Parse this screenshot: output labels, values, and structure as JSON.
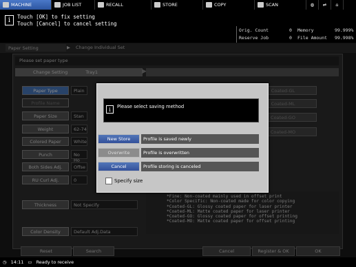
{
  "tabs": [
    {
      "label": "MACHINE",
      "icon": "machine-icon",
      "active": true
    },
    {
      "label": "JOB LIST",
      "icon": "job-list-icon"
    },
    {
      "label": "RECALL",
      "icon": "recall-icon"
    },
    {
      "label": "STORE",
      "icon": "store-icon"
    },
    {
      "label": "COPY",
      "icon": "copy-icon"
    },
    {
      "label": "SCAN",
      "icon": "scan-icon"
    }
  ],
  "message": {
    "line1": "Touch [OK] to fix setting",
    "line2": "Touch [Cancel] to cancel setting"
  },
  "counters": {
    "orig_count_label": "Orig. Count",
    "orig_count_value": "0",
    "memory_label": "Memory",
    "memory_value": "99.999%",
    "reserve_job_label": "Reserve Job",
    "reserve_job_value": "0",
    "file_amount_label": "File Amount",
    "file_amount_value": "99.998%"
  },
  "breadcrumb": {
    "item1": "Paper Setting",
    "item2": "Change Individual Set"
  },
  "panel": {
    "instruction": "Please set paper type",
    "change_setting_label": "Change Setting",
    "tray_label": "Tray1",
    "buttons": [
      {
        "label": "Paper Type",
        "value": "Plain"
      },
      {
        "label": "Profile Name",
        "value": ""
      },
      {
        "label": "Paper Size",
        "value": "Stan"
      },
      {
        "label": "Weight",
        "value": "62-74"
      },
      {
        "label": "Colored Paper",
        "value": "White"
      },
      {
        "label": "Punch",
        "value": "No Ho"
      },
      {
        "label": "Both Sides Adj.",
        "value": "Offse"
      },
      {
        "label": "RU Curl Adj.",
        "value": "0"
      }
    ],
    "thickness_label": "Thickness",
    "thickness_value": "Not Specify",
    "color_density_label": "Color Density",
    "color_density_value": "Default Adj.Data",
    "right_buttons": [
      "Coated-GL",
      "Coated-ML",
      "Coated-GO",
      "Coated-MO"
    ],
    "description_lines": [
      "*Fine: Non-coated mainly used in offset print",
      "*Color Specific: Non-coated made for color copying",
      "*Coated-GL: Glossy coated paper for laser printer",
      "*Coated-ML: Matte coated paper for laser printer",
      "*Coated-GO: Glossy coated paper for offset printing",
      "*Coated-MO: Matte coated paper for offset printing"
    ],
    "bottom_buttons": {
      "reset": "Reset",
      "search": "Search",
      "cancel": "Cancel",
      "register_ok": "Register & OK",
      "ok": "OK"
    }
  },
  "status": {
    "time": "14:11",
    "text": "Ready to receive"
  },
  "dialog": {
    "message": "Please select saving method",
    "options": [
      {
        "label": "New Store",
        "description": "Profile is saved newly"
      },
      {
        "label": "Overwrite",
        "description": "Profile is overwritten"
      },
      {
        "label": "Cancel",
        "description": "Profile storing is canceled"
      }
    ],
    "specify_size_label": "Specify size"
  }
}
